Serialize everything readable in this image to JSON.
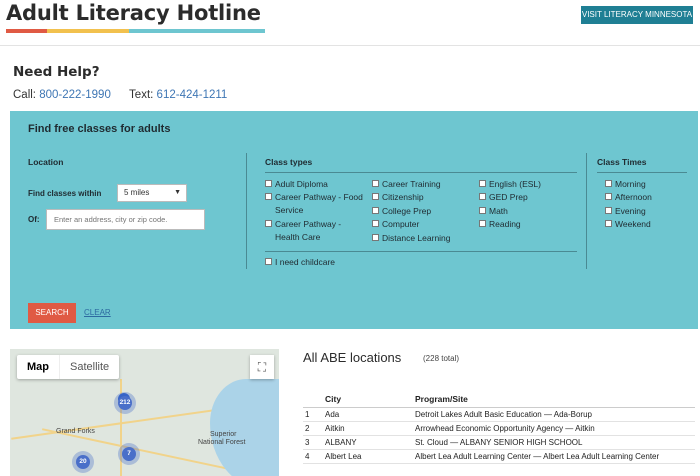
{
  "header": {
    "title": "Adult Literacy Hotline",
    "visit_button": "VISIT LITERACY MINNESOTA",
    "underline_colors": [
      "#e05a44",
      "#f2c14e",
      "#6ec6d0"
    ]
  },
  "help": {
    "heading": "Need Help?",
    "call_label": "Call:",
    "call_number": "800-222-1990",
    "text_label": "Text:",
    "text_number": "612-424-1211"
  },
  "search": {
    "heading": "Find free classes for adults",
    "location_title": "Location",
    "find_within_label": "Find classes within",
    "miles_value": "5 miles",
    "of_label": "Of:",
    "address_placeholder": "Enter an address, city or zip code.",
    "class_types_title": "Class types",
    "class_types": [
      {
        "label": "Adult Diploma",
        "checked": false
      },
      {
        "label": "Career Pathway - Food Service",
        "checked": false
      },
      {
        "label": "Career Pathway - Health Care",
        "checked": false
      },
      {
        "label": "Career Training",
        "checked": false
      },
      {
        "label": "Citizenship",
        "checked": false
      },
      {
        "label": "College Prep",
        "checked": false
      },
      {
        "label": "Computer",
        "checked": false
      },
      {
        "label": "Distance Learning",
        "checked": false
      },
      {
        "label": "English (ESL)",
        "checked": false
      },
      {
        "label": "GED Prep",
        "checked": false
      },
      {
        "label": "Math",
        "checked": false
      },
      {
        "label": "Reading",
        "checked": false
      }
    ],
    "childcare_label": "I need childcare",
    "class_times_title": "Class Times",
    "class_times": [
      {
        "label": "Morning",
        "checked": false
      },
      {
        "label": "Afternoon",
        "checked": false
      },
      {
        "label": "Evening",
        "checked": false
      },
      {
        "label": "Weekend",
        "checked": false
      }
    ],
    "search_button": "SEARCH",
    "clear_link": "CLEAR",
    "panel_color": "#6ec6d0",
    "search_button_color": "#e05a44"
  },
  "map": {
    "tab_map": "Map",
    "tab_satellite": "Satellite",
    "label_grand_forks": "Grand Forks",
    "label_superior": "Superior",
    "label_national_forest": "National Forest",
    "cluster_a": "212",
    "cluster_b": "7",
    "cluster_c": "20"
  },
  "locations": {
    "heading": "All ABE locations",
    "total": "(228 total)",
    "columns": [
      "",
      "City",
      "Program/Site"
    ],
    "rows": [
      {
        "num": "1",
        "city": "Ada",
        "site": "Detroit Lakes Adult Basic Education — Ada-Borup"
      },
      {
        "num": "2",
        "city": "Aitkin",
        "site": "Arrowhead Economic Opportunity Agency — Aitkin"
      },
      {
        "num": "3",
        "city": "ALBANY",
        "site": "St. Cloud — ALBANY SENIOR HIGH SCHOOL"
      },
      {
        "num": "4",
        "city": "Albert Lea",
        "site": "Albert Lea Adult Learning Center — Albert Lea Adult Learning Center"
      }
    ]
  }
}
